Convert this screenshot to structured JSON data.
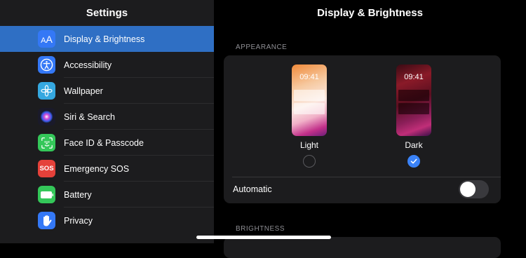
{
  "sidebar": {
    "title": "Settings",
    "items": [
      {
        "label": "Display & Brightness",
        "icon": "display-brightness-icon",
        "color": "#3478f6",
        "selected": true
      },
      {
        "label": "Accessibility",
        "icon": "accessibility-icon",
        "color": "#3478f6"
      },
      {
        "label": "Wallpaper",
        "icon": "wallpaper-icon",
        "color": "#35a8e0"
      },
      {
        "label": "Siri & Search",
        "icon": "siri-icon",
        "color": "#222222"
      },
      {
        "label": "Face ID & Passcode",
        "icon": "face-id-icon",
        "color": "#34c759"
      },
      {
        "label": "Emergency SOS",
        "icon": "sos-icon",
        "color": "#e5413a",
        "icon_text": "SOS"
      },
      {
        "label": "Battery",
        "icon": "battery-icon",
        "color": "#34c759"
      },
      {
        "label": "Privacy",
        "icon": "privacy-hand-icon",
        "color": "#3478f6"
      }
    ]
  },
  "main": {
    "title": "Display & Brightness",
    "appearance_header": "APPEARANCE",
    "light": {
      "label": "Light",
      "time": "09:41",
      "selected": false
    },
    "dark": {
      "label": "Dark",
      "time": "09:41",
      "selected": true
    },
    "automatic": {
      "label": "Automatic",
      "on": false
    },
    "brightness_header": "BRIGHTNESS"
  },
  "colors": {
    "accent": "#3a82f7",
    "selection": "#2f6fc4",
    "sidebar_bg": "#1c1c1e",
    "card_bg": "#1c1c1e"
  }
}
